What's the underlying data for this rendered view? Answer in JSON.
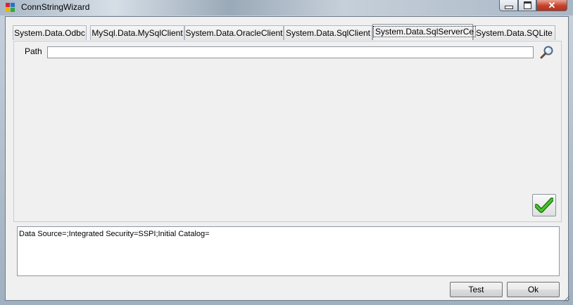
{
  "window": {
    "title": "ConnStringWizard",
    "close_glyph": "✕"
  },
  "tabs": [
    {
      "label": "System.Data.Odbc",
      "active": false
    },
    {
      "label": "MySql.Data.MySqlClient",
      "active": false
    },
    {
      "label": "System.Data.OracleClient",
      "active": false
    },
    {
      "label": "System.Data.SqlClient",
      "active": false
    },
    {
      "label": "System.Data.SqlServerCe",
      "active": true
    },
    {
      "label": "System.Data.SQLite",
      "active": false
    }
  ],
  "form": {
    "path_label": "Path",
    "path_value": "",
    "browse_icon": "magnifier-icon",
    "apply_icon": "checkmark-icon"
  },
  "connection_string": "Data Source=;Integrated Security=SSPI;Initial Catalog=",
  "buttons": {
    "test_label": "Test",
    "ok_label": "Ok"
  },
  "colors": {
    "check_green": "#2e9a1c",
    "close_red": "#c4422b"
  }
}
